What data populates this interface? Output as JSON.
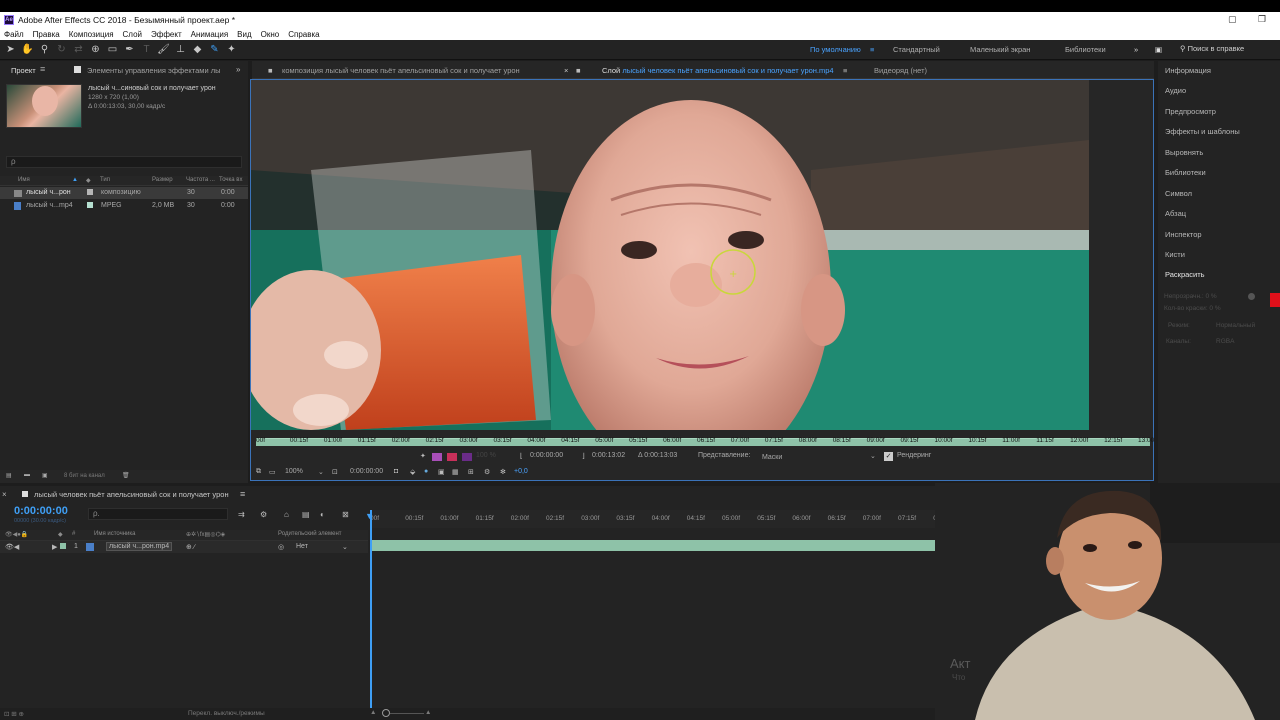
{
  "window": {
    "title": "Adobe After Effects CC 2018 - Безымянный проект.aep *",
    "app_icon": "Ae"
  },
  "menu": [
    "Файл",
    "Правка",
    "Композиция",
    "Слой",
    "Эффект",
    "Анимация",
    "Вид",
    "Окно",
    "Справка"
  ],
  "workspaces": {
    "default": "По умолчанию",
    "standard": "Стандартный",
    "small_screen": "Маленький экран",
    "libraries": "Библиотеки",
    "search_help": "Поиск в справке"
  },
  "project_panel": {
    "tab_project": "Проект",
    "tab_effects": "Элементы управления эффектами лы",
    "item_name": "лысый ч...синовый сок и получает урон",
    "item_size": "1280 x 720 (1,00)",
    "item_duration": "Δ 0:00:13:03, 30,00 кадр/с",
    "search_placeholder": "ρ",
    "columns": {
      "name": "Имя",
      "type": "Тип",
      "size": "Размер",
      "fps": "Частота ...",
      "inpoint": "Точка вх"
    },
    "files": [
      {
        "name": "лысый ч...рон",
        "type": "композицию",
        "size": "",
        "fps": "30",
        "inpoint": "0:00"
      },
      {
        "name": "лысый ч...mp4",
        "type": "MPEG",
        "size": "2,0 MB",
        "fps": "30",
        "inpoint": "0:00"
      }
    ],
    "footer_bits": "8 бит на канал"
  },
  "viewer": {
    "tab_composition": "композиция лысый человек пьёт апельсиновый сок и получает урон",
    "tab_layer_prefix": "Слой",
    "tab_layer_name": "лысый человек пьёт апельсиновый сок и получает урон.mp4",
    "tab_footage": "Видеоряд (нет)",
    "ruler_ticks": [
      "00f",
      "00:15f",
      "01:00f",
      "01:15f",
      "02:00f",
      "02:15f",
      "03:00f",
      "03:15f",
      "04:00f",
      "04:15f",
      "05:00f",
      "05:15f",
      "06:00f",
      "06:15f",
      "07:00f",
      "07:15f",
      "08:00f",
      "08:15f",
      "09:00f",
      "09:15f",
      "10:00f",
      "10:15f",
      "11:00f",
      "11:15f",
      "12:00f",
      "12:15f",
      "13:00"
    ],
    "time_in": "0:00:00:00",
    "time_out": "0:00:13:02",
    "time_duration": "Δ 0:00:13:03",
    "view_label": "Представление:",
    "view_value": "Маски",
    "render_label": "Рендеринг",
    "zoom": "100%",
    "current_time": "0:00:00:00",
    "exposure": "+0,0",
    "opacity_hint": "100 %"
  },
  "right_panel": {
    "items": [
      "Информация",
      "Аудио",
      "Предпросмотр",
      "Эффекты и шаблоны",
      "Выровнять",
      "Библиотеки",
      "Символ",
      "Абзац",
      "Инспектор",
      "Кисти",
      "Раскрасить"
    ],
    "paint": {
      "opacity": "Непрозрачн.: 0 %",
      "flow": "Кол-во краски: 0 %",
      "mode_label": "Режим:",
      "mode_value": "Нормальный",
      "channels_label": "Каналы:",
      "channels_value": "RGBA"
    }
  },
  "timeline": {
    "tab": "лысый человек пьёт апельсиновый сок и получает урон",
    "timecode": "0:00:00:00",
    "timecode_sub": "00000 (30.00 кадр/с)",
    "search_placeholder": "ρ.",
    "columns": {
      "source_name": "Имя источника",
      "parent": "Родительский элемент"
    },
    "layer": {
      "index": "1",
      "name": "лысый ч...рон.mp4",
      "parent": "Нет"
    },
    "ticks": [
      "00f",
      "00:15f",
      "01:00f",
      "01:15f",
      "02:00f",
      "02:15f",
      "03:00f",
      "03:15f",
      "04:00f",
      "04:15f",
      "05:00f",
      "05:15f",
      "06:00f",
      "06:15f",
      "07:00f",
      "07:15f",
      "08:00f",
      "08:15f",
      "09:00f",
      "09:15f",
      "11:15f",
      "12:00f",
      "12:15f"
    ]
  },
  "status_bar": {
    "toggle_label": "Перекл. выключ./режимы"
  },
  "watermark": {
    "line1": "Акт",
    "line2": "Что"
  },
  "colors": {
    "accent": "#3f9ff5",
    "track": "#8ec2a8",
    "panel": "#232323",
    "red_swatch": "#e0101a"
  }
}
